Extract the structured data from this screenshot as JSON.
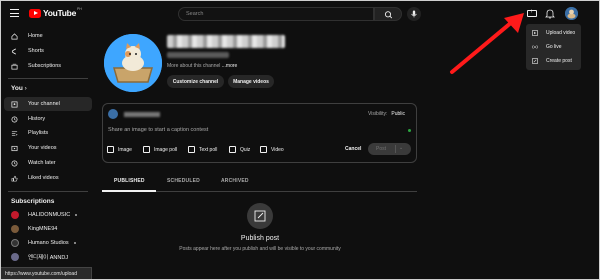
{
  "topbar": {
    "logo_text": "YouTube",
    "logo_sup": "PH",
    "search_placeholder": "Search"
  },
  "sidebar": {
    "main_items": [
      {
        "label": "Home",
        "icon": "home-icon"
      },
      {
        "label": "Shorts",
        "icon": "shorts-icon"
      },
      {
        "label": "Subscriptions",
        "icon": "subscriptions-icon"
      }
    ],
    "you_heading": "You",
    "you_chevron": "›",
    "you_items": [
      {
        "label": "Your channel",
        "icon": "channel-icon",
        "active": true
      },
      {
        "label": "History",
        "icon": "history-icon"
      },
      {
        "label": "Playlists",
        "icon": "playlists-icon"
      },
      {
        "label": "Your videos",
        "icon": "your-videos-icon"
      },
      {
        "label": "Watch later",
        "icon": "watch-later-icon"
      },
      {
        "label": "Liked videos",
        "icon": "liked-videos-icon"
      }
    ],
    "subscriptions_heading": "Subscriptions",
    "subscriptions": [
      {
        "label": "HALIDONMUSIC",
        "dot": true,
        "color": "#c21a2c"
      },
      {
        "label": "KingMNE94",
        "dot": false,
        "color": "#7a5a3a"
      },
      {
        "label": "Humano Studios",
        "dot": true,
        "color": "#333333"
      },
      {
        "label": "엔디제이 ANNDJ",
        "dot": false,
        "color": "#6a6a8a"
      }
    ]
  },
  "channel": {
    "more_text": "More about this channel",
    "more_link": "...more",
    "customize_label": "Customize channel",
    "manage_label": "Manage videos"
  },
  "post_card": {
    "visibility_label": "Visibility:",
    "visibility_value": "Public",
    "prompt": "Share an image to start a caption contest",
    "tools": [
      "Image",
      "Image poll",
      "Text poll",
      "Quiz",
      "Video"
    ],
    "cancel_label": "Cancel",
    "post_label": "Post",
    "post_chevron": "⌄"
  },
  "tabs": [
    {
      "label": "PUBLISHED",
      "active": true
    },
    {
      "label": "SCHEDULED",
      "active": false
    },
    {
      "label": "ARCHIVED",
      "active": false
    }
  ],
  "empty_state": {
    "title": "Publish post",
    "subtitle": "Posts appear here after you publish and will be visible to your community"
  },
  "status_url": "https://www.youtube.com/upload",
  "create_menu": {
    "items": [
      {
        "label": "Upload video",
        "icon": "upload-video-icon"
      },
      {
        "label": "Go live",
        "icon": "go-live-icon"
      },
      {
        "label": "Create post",
        "icon": "create-post-icon"
      }
    ]
  },
  "colors": {
    "background": "#0f0f0f",
    "brand_red": "#ff0000",
    "annotation_arrow": "#ff1a1a",
    "avatar_blue": "#3ea6ff"
  }
}
